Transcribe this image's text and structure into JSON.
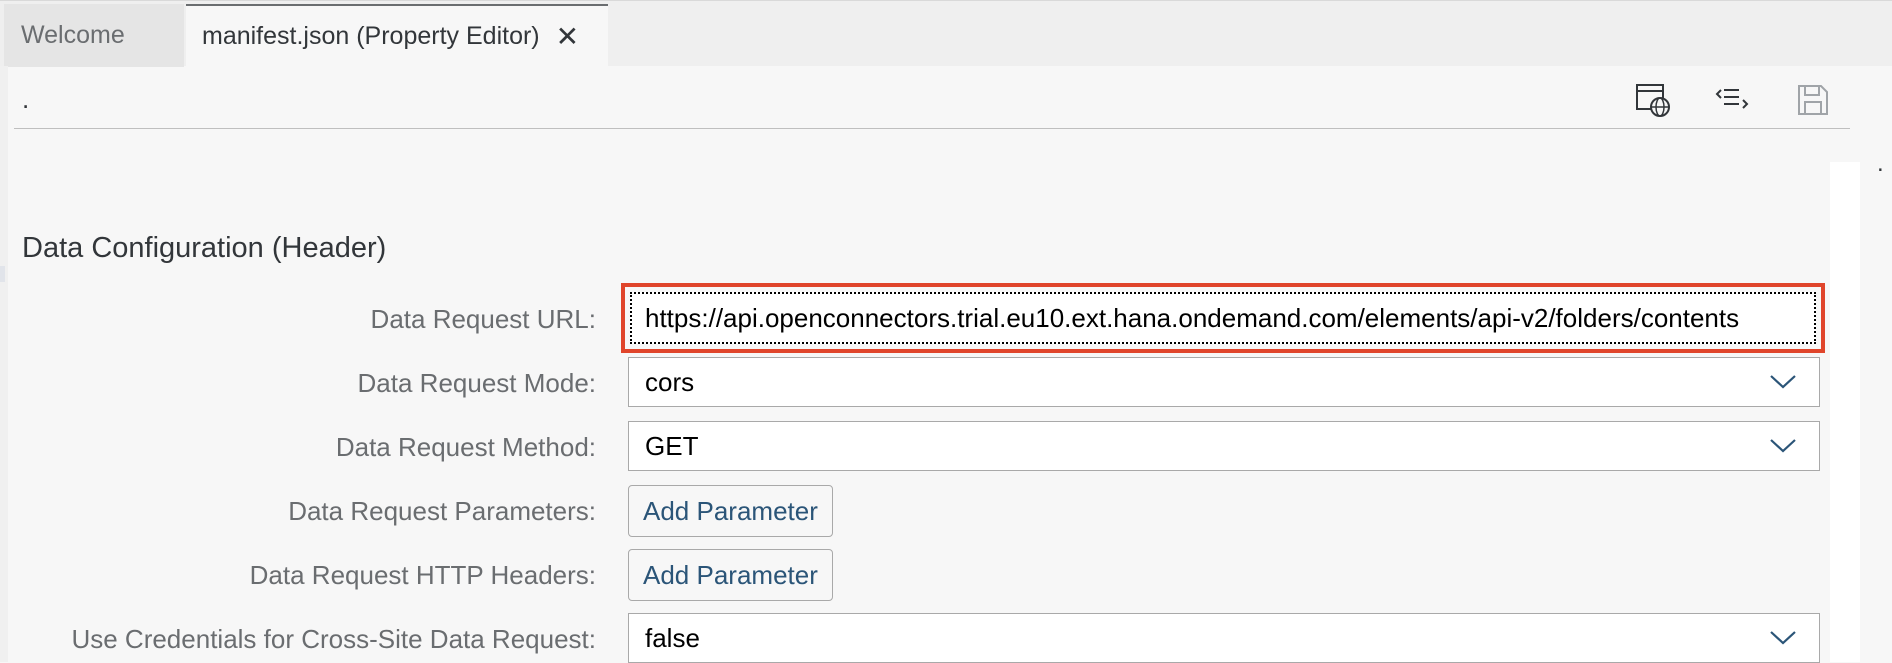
{
  "tabs": [
    {
      "label": "Welcome"
    },
    {
      "label": "manifest.json (Property Editor)",
      "close_glyph": "✕"
    }
  ],
  "toolbar": {
    "dot": ".",
    "icons": [
      "preview-globe-icon",
      "code-view-icon",
      "save-icon"
    ]
  },
  "right_panel": {
    "dot": "."
  },
  "section": {
    "title": "Data Configuration (Header)"
  },
  "form": {
    "url": {
      "label": "Data Request URL:",
      "value": "https://api.openconnectors.trial.eu10.ext.hana.ondemand.com/elements/api-v2/folders/contents"
    },
    "mode": {
      "label": "Data Request Mode:",
      "value": "cors"
    },
    "method": {
      "label": "Data Request Method:",
      "value": "GET"
    },
    "params": {
      "label": "Data Request Parameters:",
      "button": "Add Parameter"
    },
    "headers": {
      "label": "Data Request HTTP Headers:",
      "button": "Add Parameter"
    },
    "credentials": {
      "label": "Use Credentials for Cross-Site Data Request:",
      "value": "false"
    }
  },
  "colors": {
    "highlight": "#e0452b",
    "link": "#2b5578",
    "label": "#6a6d70"
  }
}
